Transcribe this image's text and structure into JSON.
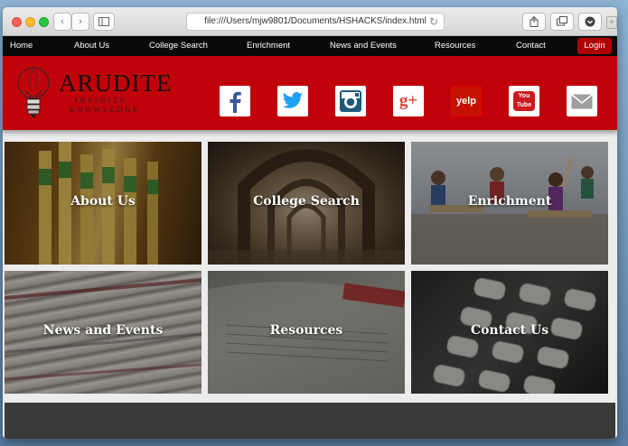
{
  "browser": {
    "url": "file:///Users/mjw9801/Documents/HSHACKS/index.html"
  },
  "nav": {
    "items": [
      "Home",
      "About Us",
      "College Search",
      "Enrichment",
      "News and Events",
      "Resources",
      "Contact"
    ],
    "login": "Login"
  },
  "brand": {
    "name": "ARUDITE",
    "tagline_1": "INFINITE",
    "tagline_2": "KNOWLEDGE"
  },
  "social": [
    "facebook-icon",
    "twitter-icon",
    "instagram-icon",
    "google-plus-icon",
    "yelp-icon",
    "youtube-icon",
    "mail-icon"
  ],
  "social_labels": {
    "google_plus": "g+",
    "yelp": "yelp",
    "youtube": "You Tube"
  },
  "tiles": [
    "About Us",
    "College Search",
    "Enrichment",
    "News and Events",
    "Resources",
    "Contact Us"
  ],
  "colors": {
    "brand_red": "#c0020a",
    "nav_black": "#0a0a0a",
    "login_red": "#b00000",
    "facebook": "#3b5998",
    "twitter": "#1da1f2",
    "instagram": "#1e5a7a",
    "google_plus": "#d34836",
    "yelp": "#c41200",
    "youtube": "#cc181e"
  }
}
